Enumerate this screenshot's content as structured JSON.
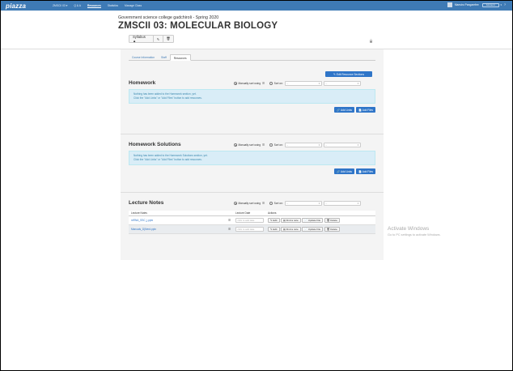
{
  "navbar": {
    "logo": "piazza",
    "items": [
      {
        "label": "ZMSCII 03 ▾"
      },
      {
        "label": "Q & A"
      },
      {
        "label": "Resources",
        "active": true
      },
      {
        "label": "Statistics"
      },
      {
        "label": "Manage Class"
      }
    ],
    "user": "Maestro Pangarefee",
    "btn": "Account",
    "caret": "▾",
    "help": "?"
  },
  "header": {
    "subtitle": "Government science college gadchiroli - Spring 2020",
    "title": "ZMSCII 03: MOLECULAR BIOLOGY",
    "syllabus_label": "Syllabus ▲",
    "pencil_glyph": "✎",
    "trash_glyph": "🗑"
  },
  "tabs": [
    {
      "label": "Course Information"
    },
    {
      "label": "Staff"
    },
    {
      "label": "Resources",
      "active": true
    }
  ],
  "edit_sections_label": "✎ Edit Resource Sections",
  "sort": {
    "manual_label": "Manually sort using",
    "sorton_label": "Sort on:",
    "grip": "☰",
    "select_a": "--",
    "select_b": "--",
    "caret": "▾"
  },
  "homework": {
    "title": "Homework",
    "info_line1": "Nothing has been added to the Homework section, yet.",
    "info_line2": "Click the \"Add Links\" or \"Add Files\" button to add resources.",
    "add_links": "🔗 Add Links",
    "add_files": "📄 Add Files"
  },
  "solutions": {
    "title": "Homework Solutions",
    "info_line1": "Nothing has been added to the Homework Solutions section, yet.",
    "info_line2": "Click the \"Add Links\" or \"Add Files\" button to add resources.",
    "add_links": "🔗 Add Links",
    "add_files": "📄 Add Files"
  },
  "lecture": {
    "title": "Lecture Notes",
    "headers": {
      "notes": "Lecture Notes",
      "date": "Lecture Date",
      "actions": "Actions"
    },
    "date_placeholder": "click to add date",
    "actions": {
      "edit": "✎ Edit",
      "find": "▤ Find a note",
      "update": "📄 Update File",
      "delete": "🗑 Delete"
    },
    "rows": [
      {
        "name": "mRNA_SSC_j.pptx"
      },
      {
        "name": "Manuals_D(Nerd.pptx"
      }
    ]
  },
  "watermark": {
    "line1": "Activate Windows",
    "line2": "Go to PC settings to activate Windows."
  },
  "colors": {
    "navbar": "#3e7ab5",
    "primary_button": "#2f75c8",
    "info_bg": "#d9edf7"
  }
}
